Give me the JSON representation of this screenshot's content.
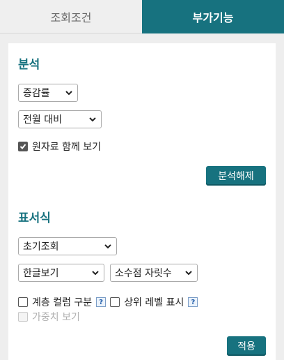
{
  "tabs": [
    {
      "label": "조회조건",
      "active": false
    },
    {
      "label": "부가기능",
      "active": true
    }
  ],
  "analysis": {
    "title": "분석",
    "type_select": "증감률",
    "compare_select": "전월 대비",
    "show_raw_label": "원자료 함께 보기",
    "show_raw_checked": true,
    "release_button": "분석해제"
  },
  "format": {
    "title": "표서식",
    "initial_select": "초기조회",
    "language_select": "한글보기",
    "decimal_select": "소수점 자릿수",
    "hier_column_label": "계층 컬럼 구분",
    "upper_level_label": "상위 레벨 표시",
    "weight_label": "가중치 보기",
    "help_glyph": "?",
    "apply_button": "적용"
  },
  "colors": {
    "accent": "#17727f"
  }
}
